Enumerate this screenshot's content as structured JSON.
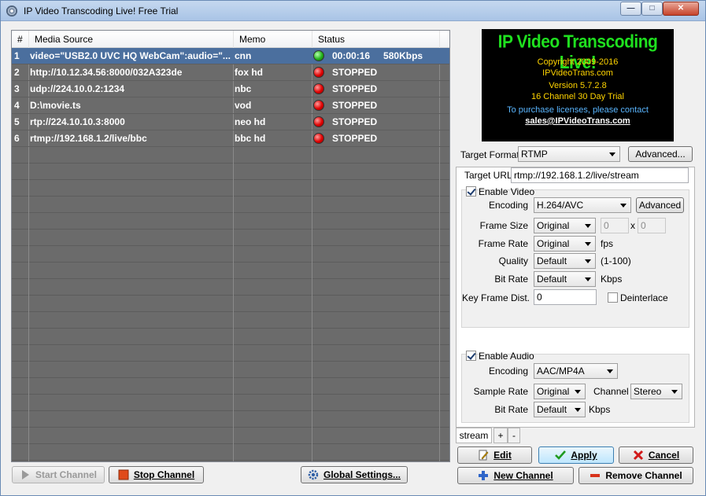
{
  "window": {
    "title": "IP Video Transcoding Live! Free Trial"
  },
  "table": {
    "headers": {
      "num": "#",
      "source": "Media Source",
      "memo": "Memo",
      "status": "Status"
    },
    "rows": [
      {
        "num": "1",
        "source": "video=\"USB2.0 UVC HQ WebCam\":audio=\"...",
        "memo": "cnn",
        "status": "00:00:16",
        "rate": "580Kbps",
        "state": "green"
      },
      {
        "num": "2",
        "source": "http://10.12.34.56:8000/032A323de",
        "memo": "fox hd",
        "status": "STOPPED",
        "rate": "",
        "state": "red"
      },
      {
        "num": "3",
        "source": "udp://224.10.0.2:1234",
        "memo": "nbc",
        "status": "STOPPED",
        "rate": "",
        "state": "red"
      },
      {
        "num": "4",
        "source": "D:\\movie.ts",
        "memo": "vod",
        "status": "STOPPED",
        "rate": "",
        "state": "red"
      },
      {
        "num": "5",
        "source": "rtp://224.10.10.3:8000",
        "memo": "neo hd",
        "status": "STOPPED",
        "rate": "",
        "state": "red"
      },
      {
        "num": "6",
        "source": "rtmp://192.168.1.2/live/bbc",
        "memo": "bbc hd",
        "status": "STOPPED",
        "rate": "",
        "state": "red"
      }
    ]
  },
  "buttons": {
    "start_channel": "Start Channel",
    "stop_channel": "Stop Channel",
    "global_settings": "Global Settings...",
    "edit": "Edit",
    "apply": "Apply",
    "cancel": "Cancel",
    "new_channel": "New Channel",
    "remove_channel": "Remove Channel"
  },
  "banner": {
    "title": "IP Video Transcoding Live!",
    "copyright": "Copyright 2009-2016",
    "site": "IPVideoTrans.com",
    "version": "Version 5.7.2.8",
    "license": "16 Channel  30 Day Trial",
    "purchase": "To purchase licenses, please contact",
    "email": "sales@IPVideoTrans.com"
  },
  "settings": {
    "target_format_label": "Target Format",
    "target_format": "RTMP",
    "advanced_top": "Advanced...",
    "target_url_label": "Target URL",
    "target_url": "rtmp://192.168.1.2/live/stream",
    "enable_video": "Enable Video",
    "encoding_label": "Encoding",
    "video_encoding": "H.264/AVC",
    "advanced_video": "Advanced",
    "frame_size_label": "Frame Size",
    "frame_size": "Original",
    "frame_w": "0",
    "frame_x": "x",
    "frame_h": "0",
    "frame_rate_label": "Frame Rate",
    "frame_rate": "Original",
    "fps": "fps",
    "quality_label": "Quality",
    "quality": "Default",
    "quality_range": "(1-100)",
    "bit_rate_label": "Bit Rate",
    "video_bit_rate": "Default",
    "kbps": "Kbps",
    "key_frame_label": "Key Frame Dist.",
    "key_frame": "0",
    "deinterlace": "Deinterlace",
    "enable_audio": "Enable Audio",
    "audio_encoding": "AAC/MP4A",
    "sample_rate_label": "Sample Rate",
    "sample_rate": "Original",
    "channel_label": "Channel",
    "channel": "Stereo",
    "audio_bit_rate": "Default"
  },
  "tabs": {
    "stream": "stream",
    "add": "+",
    "remove": "-"
  },
  "colors": {
    "selected_row": "#4b6f9e",
    "grid_bg": "#6b6b6b",
    "banner_title": "#1fe01f",
    "banner_text": "#ffd400"
  }
}
